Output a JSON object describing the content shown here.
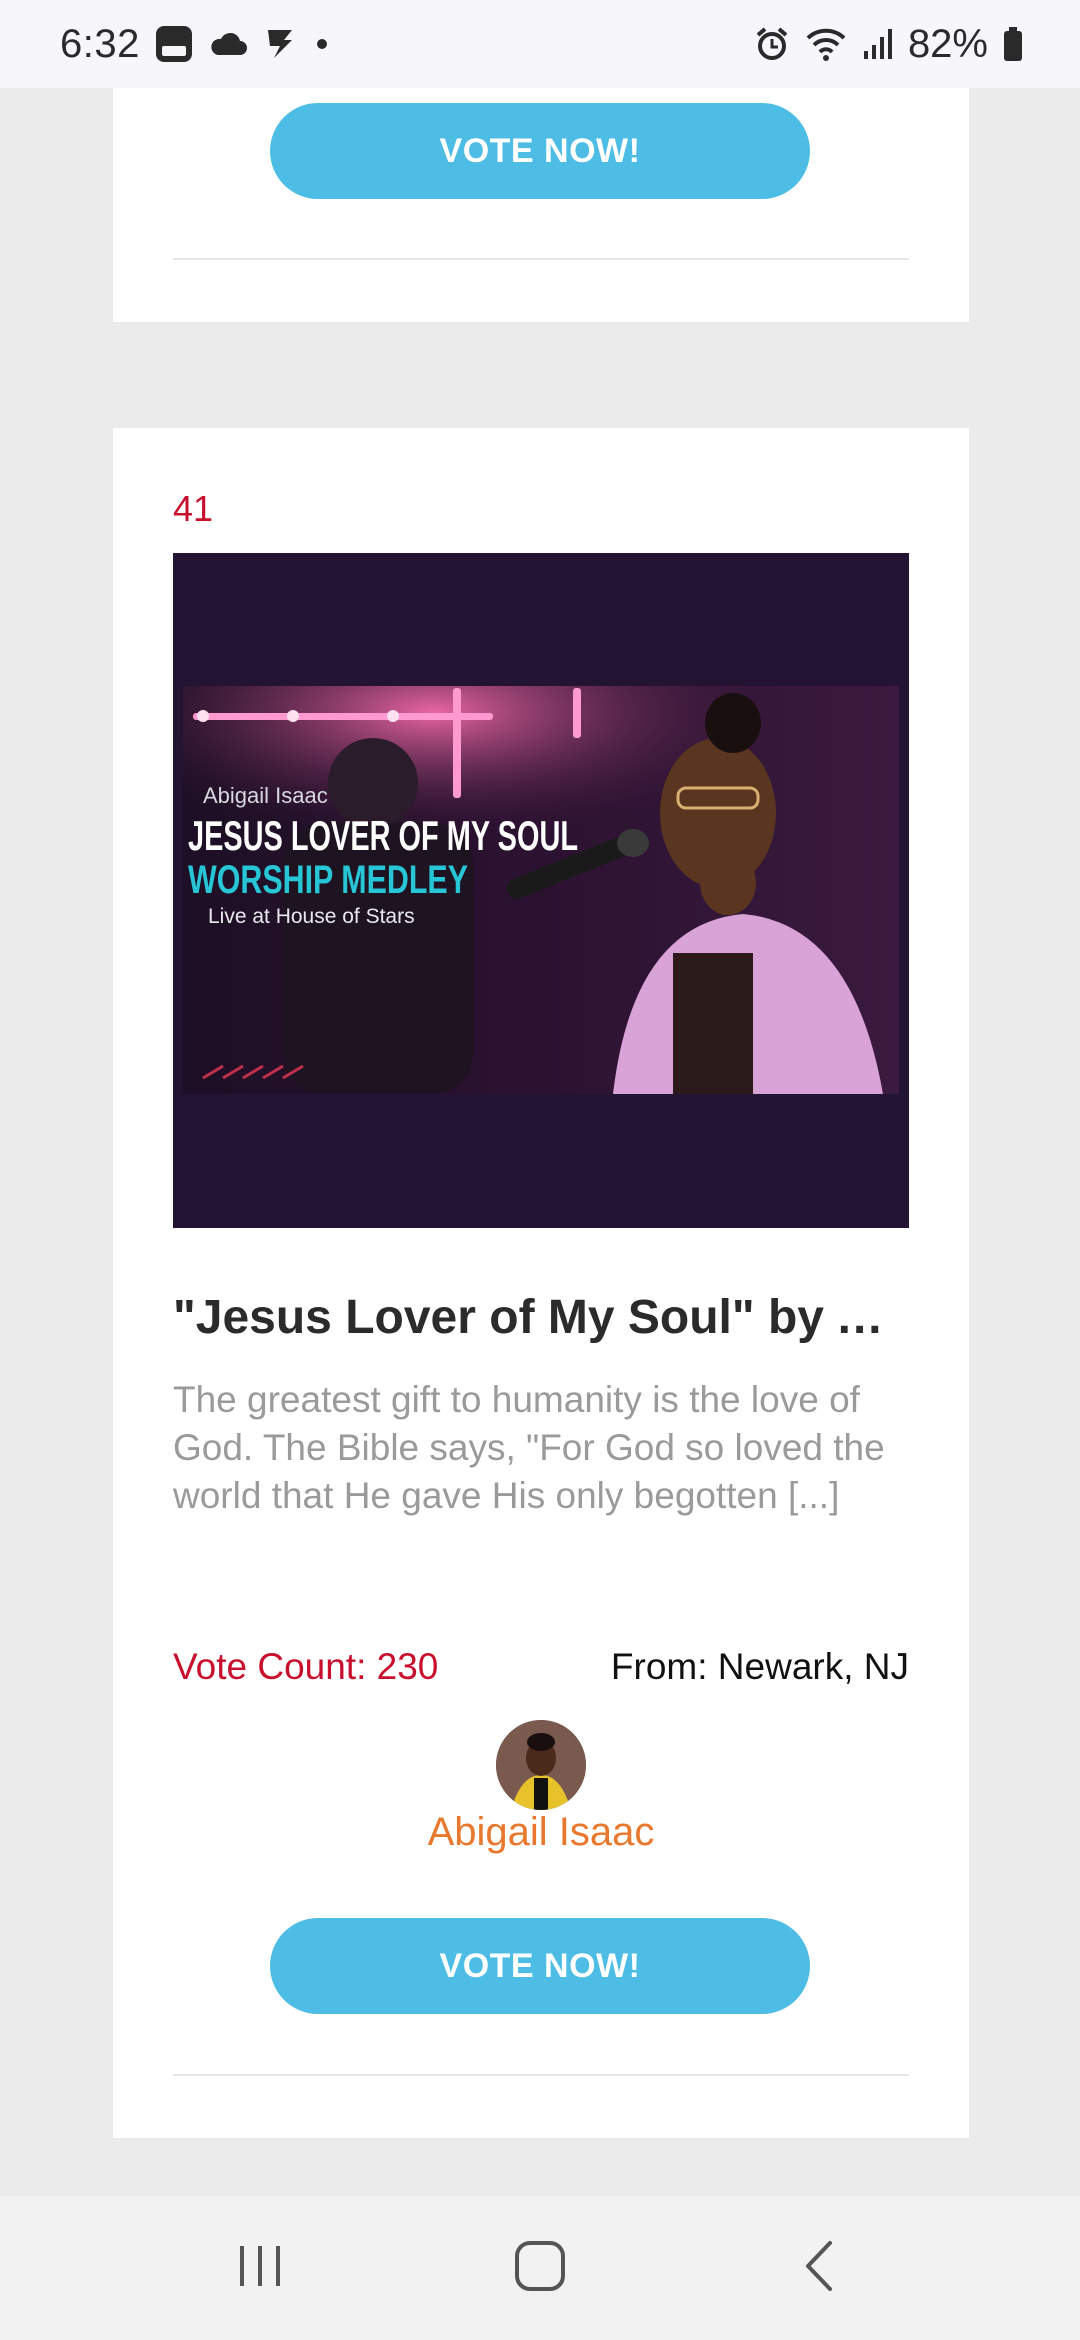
{
  "status_bar": {
    "time": "6:32",
    "battery": "82%",
    "icons_left": [
      "gallery-app-icon",
      "cloud-icon",
      "flash-app-icon",
      "dot-icon"
    ],
    "icons_right": [
      "alarm-icon",
      "wifi-icon",
      "signal-icon",
      "battery-icon"
    ]
  },
  "prev_card": {
    "vote_button": "VOTE NOW!"
  },
  "entry": {
    "rank": "41",
    "thumbnail": {
      "artist_line": "Abigail Isaac",
      "title_line": "JESUS LOVER OF MY SOUL",
      "subtitle_line": "WORSHIP MEDLEY",
      "venue_line": "Live at House of Stars"
    },
    "title": "\"Jesus Lover of My Soul\" by Abigail Isaac",
    "excerpt": "The greatest gift to humanity is the love of God. The Bible says, \"For God so loved the world that He gave His only begotten [...]",
    "vote_count": "Vote Count: 230",
    "from": "From: Newark, NJ",
    "author": "Abigail Isaac",
    "vote_button": "VOTE NOW!"
  },
  "nav": [
    "recents-icon",
    "home-icon",
    "back-icon"
  ],
  "colors": {
    "accent_button": "#4dbde6",
    "rank_red": "#c8102e",
    "author_orange": "#e8782d",
    "page_bg": "#ebebeb"
  }
}
